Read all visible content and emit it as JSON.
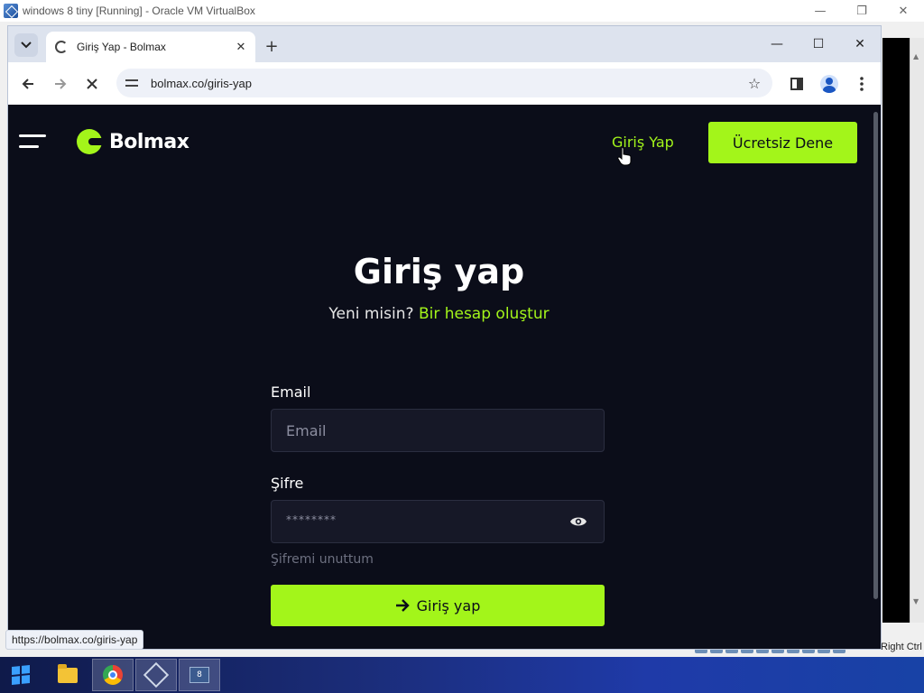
{
  "vbox": {
    "title": "windows 8 tiny [Running] - Oracle VM VirtualBox",
    "right_ctrl": "Right Ctrl"
  },
  "browser": {
    "tab": {
      "title": "Giriş Yap - Bolmax"
    },
    "url": "bolmax.co/giris-yap",
    "status_url": "https://bolmax.co/giris-yap"
  },
  "site": {
    "brand": "Bolmax",
    "nav": {
      "login": "Giriş Yap",
      "cta": "Ücretsiz Dene"
    },
    "colors": {
      "accent": "#a3f51a",
      "background": "#0b0d19"
    }
  },
  "form": {
    "heading": "Giriş yap",
    "subline_prefix": "Yeni misin?",
    "subline_link": "Bir hesap oluştur",
    "email_label": "Email",
    "email_placeholder": "Email",
    "password_label": "Şifre",
    "password_value": "********",
    "forgot": "Şifremi unuttum",
    "submit": "Giriş yap"
  },
  "icons": {
    "tab_search": "chevron-down-icon",
    "back": "arrow-left-icon",
    "forward": "arrow-right-icon",
    "reload": "stop-icon",
    "bookmark": "star-icon",
    "eye": "eye-icon"
  }
}
